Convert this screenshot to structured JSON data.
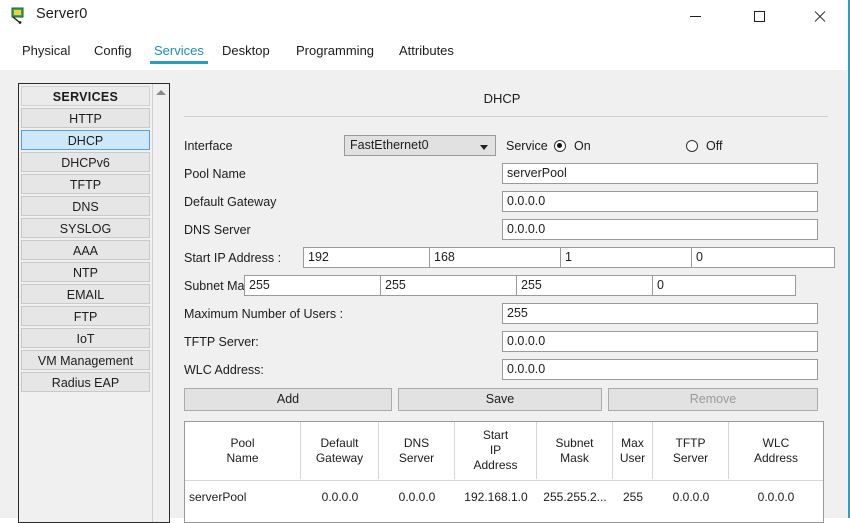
{
  "window": {
    "title": "Server0",
    "app_icon": "server-icon",
    "minimize_label": "—",
    "maximize_label": "□",
    "close_label": "✕",
    "accent_color": "#2e9fc0"
  },
  "tabs": [
    {
      "label": "Physical",
      "active": false
    },
    {
      "label": "Config",
      "active": false
    },
    {
      "label": "Services",
      "active": true
    },
    {
      "label": "Desktop",
      "active": false
    },
    {
      "label": "Programming",
      "active": false
    },
    {
      "label": "Attributes",
      "active": false
    }
  ],
  "sidebar": {
    "header": "SERVICES",
    "items": [
      {
        "label": "HTTP",
        "selected": false
      },
      {
        "label": "DHCP",
        "selected": true
      },
      {
        "label": "DHCPv6",
        "selected": false
      },
      {
        "label": "TFTP",
        "selected": false
      },
      {
        "label": "DNS",
        "selected": false
      },
      {
        "label": "SYSLOG",
        "selected": false
      },
      {
        "label": "AAA",
        "selected": false
      },
      {
        "label": "NTP",
        "selected": false
      },
      {
        "label": "EMAIL",
        "selected": false
      },
      {
        "label": "FTP",
        "selected": false
      },
      {
        "label": "IoT",
        "selected": false
      },
      {
        "label": "VM Management",
        "selected": false
      },
      {
        "label": "Radius EAP",
        "selected": false
      }
    ]
  },
  "main": {
    "title": "DHCP",
    "interface": {
      "label": "Interface",
      "value": "FastEthernet0"
    },
    "service": {
      "label": "Service",
      "on_label": "On",
      "off_label": "Off",
      "selected": "On"
    },
    "fields": {
      "pool_name": {
        "label": "Pool Name",
        "value": "serverPool"
      },
      "default_gw": {
        "label": "Default Gateway",
        "value": "0.0.0.0"
      },
      "dns_server": {
        "label": "DNS Server",
        "value": "0.0.0.0"
      },
      "start_ip": {
        "label": "Start IP Address :",
        "octets": [
          "192",
          "168",
          "1",
          "0"
        ]
      },
      "subnet_mask": {
        "label": "Subnet Mask:",
        "octets": [
          "255",
          "255",
          "255",
          "0"
        ]
      },
      "max_users": {
        "label": "Maximum Number of Users :",
        "value": "255"
      },
      "tftp_server": {
        "label": "TFTP Server:",
        "value": "0.0.0.0"
      },
      "wlc_address": {
        "label": "WLC Address:",
        "value": "0.0.0.0"
      }
    },
    "buttons": {
      "add": {
        "label": "Add",
        "disabled": false
      },
      "save": {
        "label": "Save",
        "disabled": false
      },
      "remove": {
        "label": "Remove",
        "disabled": true
      }
    },
    "table": {
      "columns": [
        "Pool\nName",
        "Default\nGateway",
        "DNS\nServer",
        "Start\nIP\nAddress",
        "Subnet\nMask",
        "Max\nUser",
        "TFTP\nServer",
        "WLC\nAddress"
      ],
      "columns_flat": [
        "Pool Name",
        "Default Gateway",
        "DNS Server",
        "Start IP Address",
        "Subnet Mask",
        "Max User",
        "TFTP Server",
        "WLC Address"
      ],
      "rows": [
        {
          "pool_name": "serverPool",
          "default_gateway": "0.0.0.0",
          "dns_server": "0.0.0.0",
          "start_ip_address": "192.168.1.0",
          "subnet_mask": "255.255.2...",
          "max_user": "255",
          "tftp_server": "0.0.0.0",
          "wlc_address": "0.0.0.0"
        }
      ]
    }
  }
}
